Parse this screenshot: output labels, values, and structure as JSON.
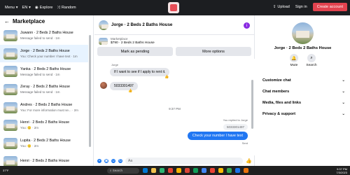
{
  "topbar": {
    "menu": "Menu",
    "lang": "EN",
    "explore": "Explore",
    "random": "Random",
    "upload": "Upload",
    "signin": "Sign in",
    "create": "Create account"
  },
  "sidebar": {
    "title": "Marketplace",
    "items": [
      {
        "name": "Juwann · 2 Beds 2 Baths House",
        "sub": "Message failed to send · 1m"
      },
      {
        "name": "Jorge · 2 Beds 2 Baths House",
        "sub": "You: Check your number I have text · 1m"
      },
      {
        "name": "Yanka · 2 Beds 2 Baths House",
        "sub": "Message failed to send · 1m"
      },
      {
        "name": "Zeray · 2 Beds 2 Baths House",
        "sub": "Message failed to send · 1m"
      },
      {
        "name": "Andres · 2 Beds 2 Baths House",
        "sub": "You: For more information must se... · 2m"
      },
      {
        "name": "Henri · 2 Beds 2 Baths House",
        "sub": "You: 🙂 · 2m"
      },
      {
        "name": "Lupita · 2 Beds 2 Baths House",
        "sub": "You: 🙂 · 2m"
      },
      {
        "name": "Henri · 2 Beds 2 Baths House",
        "sub": ""
      }
    ]
  },
  "chat": {
    "title": "Jorge · 2 Beds 2 Baths House",
    "listing_label": "Marketplace",
    "listing_detail": "$790 · 2 Beds 2 Baths House",
    "btn_pending": "Mark as pending",
    "btn_more": "More options",
    "sender": "Jorge",
    "msg1": "If I want to see if I apply to rent it.",
    "msg2": "5033301497",
    "time": "9:37 PM",
    "replied": "You replied to Jorge",
    "quote": "5033301497",
    "msg_out": "Check your number I have text",
    "sent": "Sent",
    "input_placeholder": "Aa"
  },
  "info": {
    "title": "Jorge · 2 Beds 2 Baths House",
    "mute": "Mute",
    "search": "Search",
    "rows": [
      "Customize chat",
      "Chat members",
      "Media, files and links",
      "Privacy & support"
    ]
  },
  "taskbar": {
    "weather": "37°F",
    "search": "Search",
    "time": "9:37 PM",
    "date": "7/3/2023"
  }
}
